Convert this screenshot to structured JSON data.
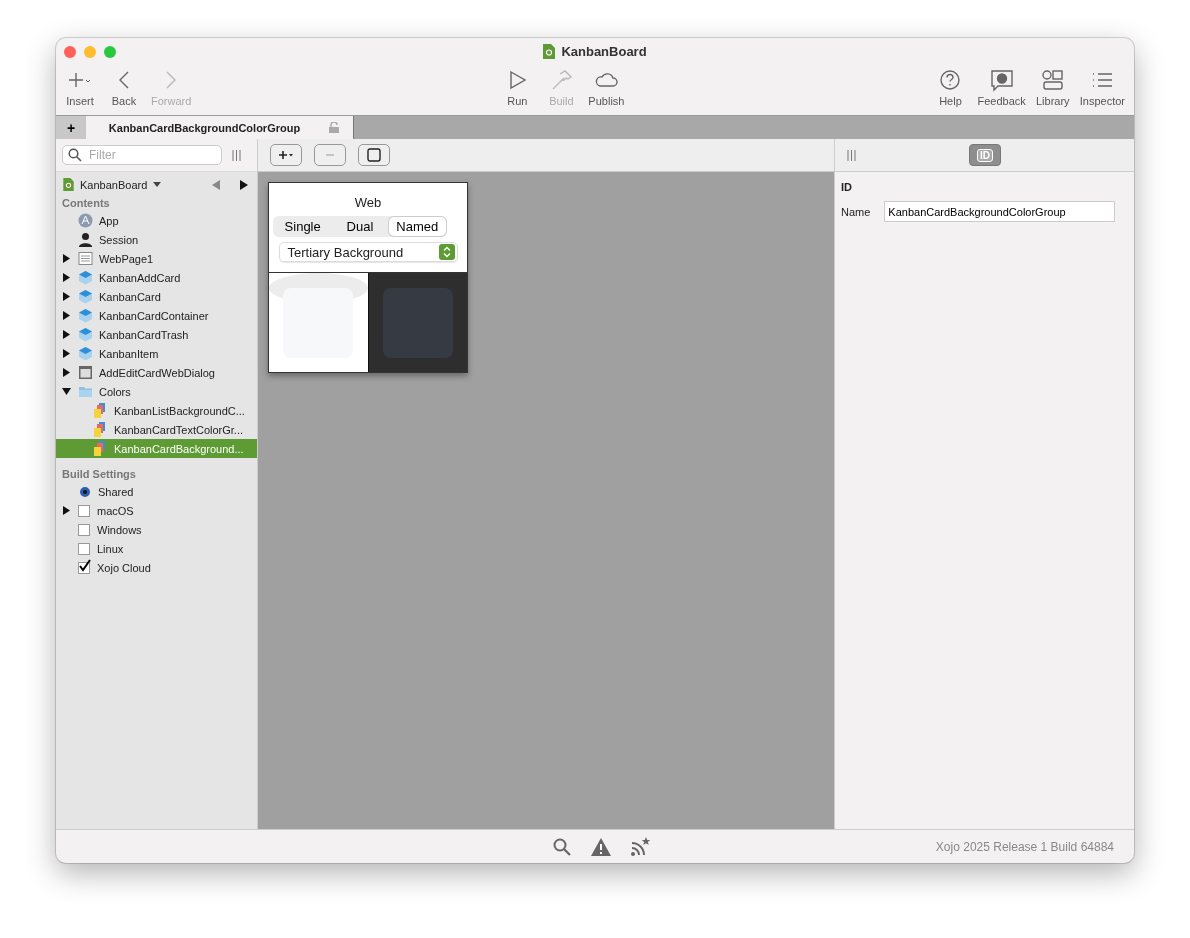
{
  "window": {
    "title": "KanbanBoard"
  },
  "toolbar": {
    "left": [
      {
        "kind": "insert",
        "label": "Insert",
        "disabled": false
      },
      {
        "kind": "back",
        "label": "Back",
        "disabled": false
      },
      {
        "kind": "forward",
        "label": "Forward",
        "disabled": true
      }
    ],
    "center": [
      {
        "kind": "run",
        "label": "Run",
        "disabled": false
      },
      {
        "kind": "build",
        "label": "Build",
        "disabled": true
      },
      {
        "kind": "publish",
        "label": "Publish",
        "disabled": false
      }
    ],
    "right": [
      {
        "kind": "help",
        "label": "Help",
        "disabled": false
      },
      {
        "kind": "feedback",
        "label": "Feedback",
        "disabled": false
      },
      {
        "kind": "library",
        "label": "Library",
        "disabled": false
      },
      {
        "kind": "inspector",
        "label": "Inspector",
        "disabled": false
      }
    ]
  },
  "tab_bar": {
    "add": "+",
    "tab": {
      "label": "KanbanCardBackgroundColorGroup"
    }
  },
  "sidebar": {
    "filter": {
      "placeholder": "Filter"
    },
    "project": {
      "name": "KanbanBoard"
    },
    "contents_heading": "Contents",
    "items": [
      {
        "kind": "app",
        "label": "App",
        "selected": false
      },
      {
        "kind": "session",
        "label": "Session",
        "selected": false
      },
      {
        "kind": "webpage",
        "label": "WebPage1",
        "selected": false,
        "expanded": false
      },
      {
        "kind": "container",
        "label": "KanbanAddCard",
        "selected": false,
        "expanded": false
      },
      {
        "kind": "container",
        "label": "KanbanCard",
        "selected": false,
        "expanded": false
      },
      {
        "kind": "container",
        "label": "KanbanCardContainer",
        "selected": false,
        "expanded": false
      },
      {
        "kind": "container",
        "label": "KanbanCardTrash",
        "selected": false,
        "expanded": false
      },
      {
        "kind": "container",
        "label": "KanbanItem",
        "selected": false,
        "expanded": false
      },
      {
        "kind": "dialog",
        "label": "AddEditCardWebDialog",
        "selected": false,
        "expanded": false
      },
      {
        "kind": "folder",
        "label": "Colors",
        "selected": false,
        "expanded": true,
        "children": [
          {
            "kind": "color",
            "label": "KanbanListBackgroundC...",
            "selected": false
          },
          {
            "kind": "color",
            "label": "KanbanCardTextColorGr...",
            "selected": false
          },
          {
            "kind": "color",
            "label": "KanbanCardBackground...",
            "selected": true
          }
        ]
      }
    ],
    "build_heading": "Build Settings",
    "build_items": [
      {
        "kind": "radio",
        "label": "Shared",
        "checked": true
      },
      {
        "kind": "checkbox",
        "label": "macOS",
        "checked": false,
        "expanded": false
      },
      {
        "kind": "checkbox",
        "label": "Windows",
        "checked": false
      },
      {
        "kind": "checkbox",
        "label": "Linux",
        "checked": false
      },
      {
        "kind": "checkbox",
        "label": "Xojo Cloud",
        "checked": true
      }
    ]
  },
  "editor": {
    "platform": "Web",
    "segments": [
      {
        "label": "Single",
        "selected": false
      },
      {
        "label": "Dual",
        "selected": false
      },
      {
        "label": "Named",
        "selected": true
      }
    ],
    "popup": {
      "value": "Tertiary Background"
    },
    "swatches": [
      {
        "kind": "light",
        "color": "#f7f8fa"
      },
      {
        "kind": "dark",
        "color": "#363a42"
      }
    ]
  },
  "inspector": {
    "tabs": [
      {
        "label": "ID",
        "selected": true
      }
    ],
    "heading": "ID",
    "fields": [
      {
        "label": "Name",
        "value": "KanbanCardBackgroundColorGroup"
      }
    ]
  },
  "status_bar": {
    "version": "Xojo 2025 Release 1 Build 64884"
  }
}
